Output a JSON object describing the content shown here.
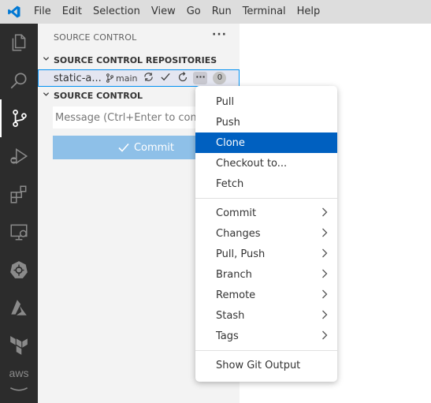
{
  "menubar": {
    "items": [
      "File",
      "Edit",
      "Selection",
      "View",
      "Go",
      "Run",
      "Terminal",
      "Help"
    ]
  },
  "activitybar": {
    "icons": [
      "explorer-icon",
      "search-icon",
      "source-control-icon",
      "run-debug-icon",
      "extensions-icon",
      "remote-explorer-icon",
      "kubernetes-icon",
      "azure-icon",
      "terraform-icon",
      "aws-icon"
    ],
    "aws_label": "aws"
  },
  "sidebar": {
    "title": "SOURCE CONTROL",
    "more": "···",
    "repos_section": "SOURCE CONTROL REPOSITORIES",
    "repo": {
      "name": "static-a...",
      "branch": "main",
      "more": "···",
      "count": "0"
    },
    "scm_section": "SOURCE CONTROL",
    "message_placeholder": "Message (Ctrl+Enter to commit on 'main')",
    "commit_label": "Commit"
  },
  "context_menu": {
    "group1": [
      "Pull",
      "Push",
      "Clone",
      "Checkout to...",
      "Fetch"
    ],
    "selected": "Clone",
    "group2": [
      "Commit",
      "Changes",
      "Pull, Push",
      "Branch",
      "Remote",
      "Stash",
      "Tags"
    ],
    "group3": [
      "Show Git Output"
    ]
  },
  "colors": {
    "activitybar": "#2c2c2c",
    "sidebar": "#f3f3f3",
    "menubar": "#dddddd",
    "selection": "#0060c0",
    "commit_button": "#8ec0e8",
    "focus_border": "#0090f1"
  }
}
